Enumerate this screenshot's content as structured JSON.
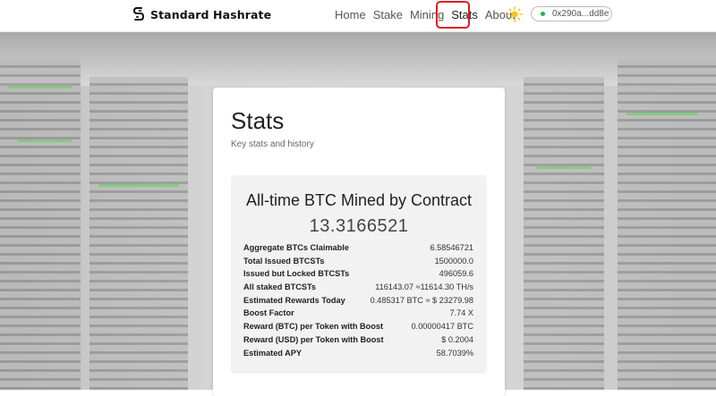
{
  "header": {
    "brand": "Standard Hashrate",
    "nav": [
      "Home",
      "Stake",
      "Mining",
      "Stats",
      "About"
    ],
    "wallet": "0x290a...dd8e"
  },
  "card": {
    "title": "Stats",
    "subtitle": "Key stats and history",
    "panel_title": "All-time BTC Mined by Contract",
    "panel_value": "13.3166521",
    "rows": [
      {
        "label": "Aggregate BTCs Claimable",
        "value": "6.58546721"
      },
      {
        "label": "Total Issued BTCSTs",
        "value": "1500000.0"
      },
      {
        "label": "Issued but Locked BTCSTs",
        "value": "496059.6"
      },
      {
        "label": "All staked BTCSTs",
        "value": "116143.07 ≈11614.30 TH/s"
      },
      {
        "label": "Estimated Rewards Today",
        "value": "0.485317 BTC  ≈ $ 23279.98"
      },
      {
        "label": "Boost Factor",
        "value": "7.74 X"
      },
      {
        "label": "Reward (BTC) per Token with Boost",
        "value": "0.00000417 BTC"
      },
      {
        "label": "Reward (USD) per Token with Boost",
        "value": "$ 0.2004"
      },
      {
        "label": "Estimated APY",
        "value": "58.7039%"
      }
    ]
  },
  "icons": {
    "logo": "logo-mark-icon",
    "theme": "sun-icon",
    "status": "connected-dot-icon"
  },
  "colors": {
    "accent_green": "#27b04b",
    "sun": "#f5c518",
    "highlight": "#e01b24"
  }
}
